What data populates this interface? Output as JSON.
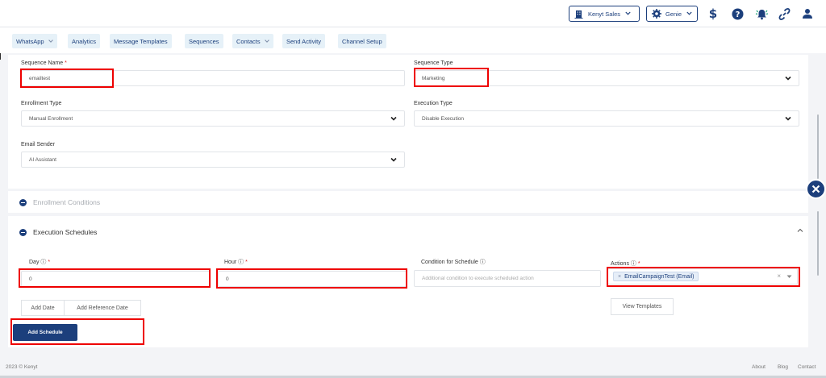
{
  "header": {
    "org_label": "Kenyt Sales",
    "genie_label": "Genie",
    "icons": [
      "building-icon",
      "gear-icon",
      "dollar-icon",
      "help-icon",
      "bell-icon",
      "link-icon",
      "user-icon"
    ]
  },
  "nav": {
    "items": [
      {
        "label": "WhatsApp",
        "has_dropdown": true
      },
      {
        "label": "Analytics",
        "has_dropdown": false
      },
      {
        "label": "Message Templates",
        "has_dropdown": false
      },
      {
        "label": "Sequences",
        "has_dropdown": false
      },
      {
        "label": "Contacts",
        "has_dropdown": true
      },
      {
        "label": "Send Activity",
        "has_dropdown": false
      },
      {
        "label": "Channel Setup",
        "has_dropdown": false
      }
    ],
    "chevron": "⌵"
  },
  "form": {
    "sequence_name_label": "Sequence Name",
    "sequence_name_value": "emailtest",
    "sequence_type_label": "Sequence Type",
    "sequence_type_value": "Marketing",
    "enrollment_type_label": "Enrollment Type",
    "enrollment_type_value": "Manual Enrollment",
    "execution_type_label": "Execution Type",
    "execution_type_value": "Disable Execution",
    "email_sender_label": "Email Sender",
    "email_sender_value": "AI Assistant",
    "required_mark": "*"
  },
  "enrollment_conditions": {
    "title": "Enrollment Conditions"
  },
  "execution_schedules": {
    "title": "Execution Schedules",
    "day_label": "Day ⓘ",
    "day_value": "0",
    "hour_label": "Hour ⓘ",
    "hour_value": "0",
    "condition_label": "Condition for Schedule ⓘ",
    "condition_placeholder": "Additional condition to execute scheduled action",
    "actions_label": "Actions ⓘ",
    "action_tag": "EmailCampaignTest (Email)",
    "tag_remove": "×",
    "clear": "×",
    "add_date": "Add Date",
    "add_reference_date": "Add Reference Date",
    "view_templates": "View Templates",
    "add_schedule": "Add Schedule",
    "collapse_caret": "^"
  },
  "footer": {
    "copyright": "2023 © Kenyt",
    "links": [
      "About",
      "Blog",
      "Contact"
    ]
  },
  "colors": {
    "primary": "#1c3f7c",
    "accent_bg": "#e6f1f8",
    "highlight": "#ff0000",
    "help_green": "#1ea37a"
  }
}
